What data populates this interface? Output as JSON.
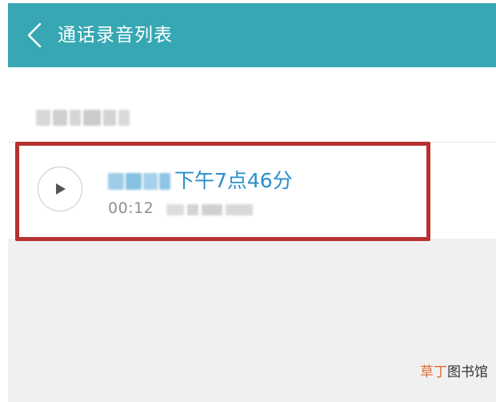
{
  "colors": {
    "accent": "#36a7b3",
    "time_text": "#2a8fc9",
    "highlight_border": "#b63130"
  },
  "header": {
    "back_icon": "chevron-left-icon",
    "title": "通话录音列表"
  },
  "recordings": [
    {
      "play_icon": "play-icon",
      "time_label": "下午7点46分",
      "duration": "00:12"
    }
  ],
  "watermark": {
    "part1": "草丁",
    "part2": "图书馆"
  }
}
